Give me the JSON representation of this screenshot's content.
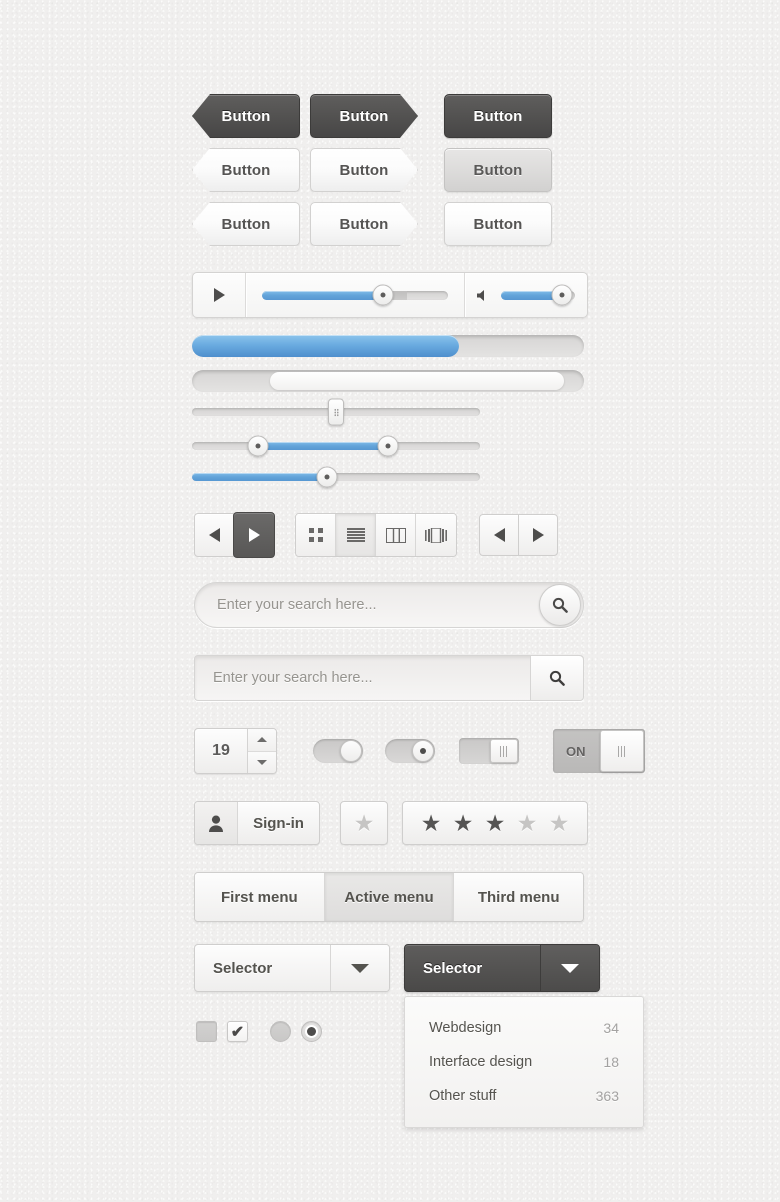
{
  "buttons": {
    "rows": [
      {
        "style": "dark",
        "items": [
          {
            "label": "Button",
            "shape": "tag-left"
          },
          {
            "label": "Button",
            "shape": "tag-right"
          },
          {
            "label": "Button",
            "shape": "rect"
          }
        ]
      },
      {
        "style": "light",
        "items": [
          {
            "label": "Button",
            "shape": "tag-left"
          },
          {
            "label": "Button",
            "shape": "tag-right"
          },
          {
            "label": "Button",
            "shape": "rect-mid"
          }
        ]
      },
      {
        "style": "light",
        "items": [
          {
            "label": "Button",
            "shape": "tag-left"
          },
          {
            "label": "Button",
            "shape": "tag-right"
          },
          {
            "label": "Button",
            "shape": "rect"
          }
        ]
      }
    ]
  },
  "media_bar": {
    "play_icon": "play-triangle-icon",
    "progress_percent": 65,
    "volume_icon": "speaker-icon",
    "volume_percent": 82
  },
  "progress_bars": [
    {
      "name": "blue-progress",
      "percent": 68
    },
    {
      "name": "white-scrollbar",
      "start_percent": 20,
      "end_percent": 95
    }
  ],
  "sliders": [
    {
      "name": "grip-slider",
      "value_percent": 50
    },
    {
      "name": "range-slider",
      "low_percent": 23,
      "high_percent": 68
    },
    {
      "name": "single-slider",
      "value_percent": 47
    }
  ],
  "toolbar": {
    "prev_icon": "arrow-left-icon",
    "play_icon": "play-triangle-icon",
    "views": [
      {
        "icon": "grid-view-icon",
        "active": false
      },
      {
        "icon": "list-view-icon",
        "active": true
      },
      {
        "icon": "column-view-icon",
        "active": false
      },
      {
        "icon": "coverflow-view-icon",
        "active": false
      }
    ],
    "nav_prev_icon": "arrow-left-icon",
    "nav_next_icon": "arrow-right-icon"
  },
  "search": {
    "rounded_placeholder": "Enter your search here...",
    "square_placeholder": "Enter your search here...",
    "icon": "search-icon"
  },
  "stepper": {
    "value": "19",
    "up_icon": "caret-up-icon",
    "down_icon": "caret-down-icon"
  },
  "toggles": [
    {
      "name": "pill-toggle-plain",
      "on": false,
      "label": ""
    },
    {
      "name": "pill-toggle-dot",
      "on": true,
      "label": ""
    },
    {
      "name": "rect-toggle",
      "on": true,
      "label": ""
    },
    {
      "name": "rect-toggle-on",
      "on": true,
      "label": "ON"
    }
  ],
  "signin": {
    "label": "Sign-in",
    "icon": "user-icon"
  },
  "rating": {
    "single_star": {
      "filled": false
    },
    "stars": [
      true,
      true,
      true,
      false,
      false
    ],
    "glyph": "★"
  },
  "menu": {
    "items": [
      {
        "label": "First menu",
        "active": false
      },
      {
        "label": "Active menu",
        "active": true
      },
      {
        "label": "Third menu",
        "active": false
      }
    ]
  },
  "selectors": [
    {
      "name": "selector-light",
      "label": "Selector",
      "theme": "light"
    },
    {
      "name": "selector-dark",
      "label": "Selector",
      "theme": "dark"
    }
  ],
  "dropdown": {
    "items": [
      {
        "label": "Webdesign",
        "count": "34"
      },
      {
        "label": "Interface design",
        "count": "18"
      },
      {
        "label": "Other stuff",
        "count": "363"
      }
    ]
  },
  "selection_controls": {
    "checkbox_off": "",
    "checkbox_on": "✔",
    "radio_off": "",
    "radio_on": ""
  },
  "colors": {
    "accent_blue": "#62a3d9",
    "dark_button": "#535251",
    "background": "#f0efee",
    "text_dark": "#54534e",
    "text_muted": "#96948f"
  }
}
